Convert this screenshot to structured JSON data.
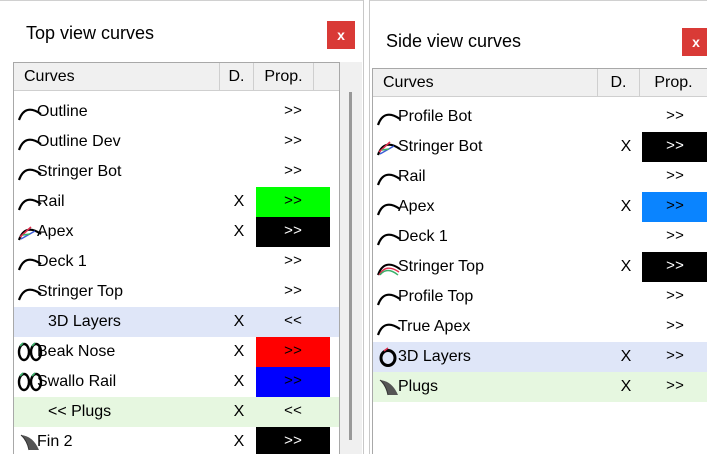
{
  "panels": [
    {
      "title": "Top view curves",
      "close_label": "x",
      "columns": {
        "curves": "Curves",
        "d": "D.",
        "prop": "Prop."
      },
      "rows": [
        {
          "label": "Outline",
          "d": "",
          "prop": ">>",
          "prop_bg": "",
          "bg": "",
          "icon": "arc-icon"
        },
        {
          "label": "Outline Dev",
          "d": "",
          "prop": ">>",
          "prop_bg": "",
          "bg": "",
          "icon": "arc-icon"
        },
        {
          "label": "Stringer Bot",
          "d": "",
          "prop": ">>",
          "prop_bg": "",
          "bg": "",
          "icon": "arc-icon"
        },
        {
          "label": "Rail",
          "d": "X",
          "prop": ">>",
          "prop_bg": "#00ff00",
          "bg": "",
          "icon": "arc-icon"
        },
        {
          "label": "Apex",
          "d": "X",
          "prop": ">>",
          "prop_bg": "#000000",
          "bg": "",
          "icon": "color-arc-icon"
        },
        {
          "label": "Deck 1",
          "d": "",
          "prop": ">>",
          "prop_bg": "",
          "bg": "",
          "icon": "arc-icon"
        },
        {
          "label": "Stringer Top",
          "d": "",
          "prop": ">>",
          "prop_bg": "",
          "bg": "",
          "icon": "arc-icon"
        },
        {
          "label": "3D Layers",
          "d": "X",
          "prop": "<<",
          "prop_bg": "",
          "bg": "#dfe6f8",
          "icon": ""
        },
        {
          "label": "Beak Nose",
          "d": "X",
          "prop": ">>",
          "prop_bg": "#ff0000",
          "bg": "",
          "icon": "double-ring-icon"
        },
        {
          "label": "Swallo Rail",
          "d": "X",
          "prop": ">>",
          "prop_bg": "#0000ff",
          "bg": "",
          "icon": "double-ring-icon"
        },
        {
          "label": "<< Plugs",
          "d": "X",
          "prop": "<<",
          "prop_bg": "",
          "bg": "#e6f7e0",
          "icon": ""
        },
        {
          "label": "Fin 2",
          "d": "X",
          "prop": ">>",
          "prop_bg": "#000000",
          "bg": "",
          "icon": "fin-icon"
        }
      ]
    },
    {
      "title": "Side view curves",
      "close_label": "x",
      "columns": {
        "curves": "Curves",
        "d": "D.",
        "prop": "Prop."
      },
      "rows": [
        {
          "label": "Profile Bot",
          "d": "",
          "prop": ">>",
          "prop_bg": "",
          "bg": "",
          "icon": "arc-icon"
        },
        {
          "label": "Stringer Bot",
          "d": "X",
          "prop": ">>",
          "prop_bg": "#000000",
          "bg": "",
          "icon": "color-arc-icon"
        },
        {
          "label": "Rail",
          "d": "",
          "prop": ">>",
          "prop_bg": "",
          "bg": "",
          "icon": "arc-icon"
        },
        {
          "label": "Apex",
          "d": "X",
          "prop": ">>",
          "prop_bg": "#0a84ff",
          "bg": "",
          "icon": "arc-icon"
        },
        {
          "label": "Deck 1",
          "d": "",
          "prop": ">>",
          "prop_bg": "",
          "bg": "",
          "icon": "arc-icon"
        },
        {
          "label": "Stringer Top",
          "d": "X",
          "prop": ">>",
          "prop_bg": "#000000",
          "bg": "",
          "icon": "multi-arc-icon"
        },
        {
          "label": "Profile Top",
          "d": "",
          "prop": ">>",
          "prop_bg": "",
          "bg": "",
          "icon": "arc-icon"
        },
        {
          "label": "True Apex",
          "d": "",
          "prop": ">>",
          "prop_bg": "",
          "bg": "",
          "icon": "arc-icon"
        },
        {
          "label": "3D Layers",
          "d": "X",
          "prop": ">>",
          "prop_bg": "",
          "bg": "#dfe6f8",
          "icon": "ring-icon"
        },
        {
          "label": "Plugs",
          "d": "X",
          "prop": ">>",
          "prop_bg": "",
          "bg": "#e6f7e0",
          "icon": "fin-icon"
        }
      ]
    }
  ]
}
